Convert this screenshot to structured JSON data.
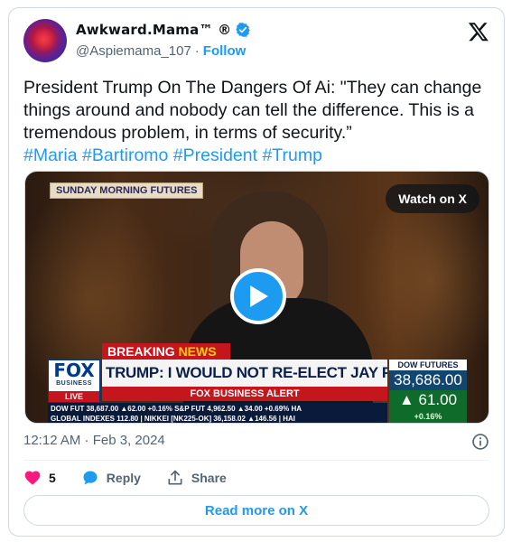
{
  "author": {
    "display_name": "Awkward.Mama™ ®",
    "handle": "@Aspiemama_107",
    "separator": "·",
    "follow_label": "Follow",
    "verified_color": "#1d9bf0"
  },
  "tweet": {
    "text": "President Trump On The Dangers Of Ai: \"They can change things around and nobody can tell the difference. This is a tremendous problem, in terms of security.”",
    "hashtags": "#Maria #Bartiromo #President #Trump",
    "timestamp": "12:12 AM · Feb 3, 2024"
  },
  "media": {
    "watch_label": "Watch on X",
    "show_tag": "SUNDAY MORNING FUTURES",
    "breaking_label": "BREAKING",
    "breaking_news": "NEWS",
    "network_logo": "FOX",
    "network_sub": "BUSINESS",
    "live_label": "LIVE",
    "headline": "TRUMP: I WOULD NOT RE-ELECT JAY POWELL",
    "alert_label": "FOX BUSINESS ALERT",
    "ticker_row1": "DOW FUT 38,687.00 ▲62.00 +0.16% S&P FUT 4,962.50 ▲34.00 +0.69% HA",
    "ticker_row2": "GLOBAL INDEXES 112.80 | NIKKEI [NK225-OK] 36,158.02 ▲146.56 | HAI",
    "dow_label": "DOW FUTURES",
    "dow_value": "38,686.00",
    "dow_change": "▲ 61.00",
    "dow_pct": "+0.16%"
  },
  "actions": {
    "like_count": "5",
    "reply_label": "Reply",
    "share_label": "Share",
    "read_more_label": "Read more on X"
  }
}
